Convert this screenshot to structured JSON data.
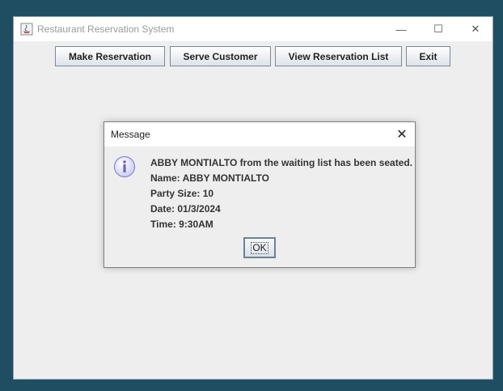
{
  "window": {
    "title": "Restaurant Reservation System",
    "controls": {
      "minimize": "—",
      "maximize": "☐",
      "close": "✕"
    }
  },
  "toolbar": {
    "make_reservation_label": "Make Reservation",
    "serve_customer_label": "Serve Customer",
    "view_list_label": "View Reservation List",
    "exit_label": "Exit"
  },
  "dialog": {
    "title": "Message",
    "close_symbol": "✕",
    "icon": "info-icon",
    "lines": [
      "ABBY MONTIALTO from the waiting list has been seated.",
      "Name: ABBY MONTIALTO",
      "Party Size: 10",
      "Date: 01/3/2024",
      "Time: 9:30AM"
    ],
    "ok_label": "OK"
  },
  "colors": {
    "desktop": "#1f4e63",
    "window_bg": "#eeeeee",
    "info_icon": "#8a86d8"
  }
}
